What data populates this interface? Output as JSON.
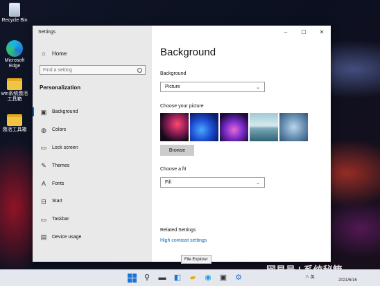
{
  "desktop": {
    "icons": [
      {
        "label": "Recycle Bin",
        "icon": "recycle-bin-icon"
      },
      {
        "label": "Microsoft Edge",
        "icon": "edge-icon"
      },
      {
        "label": "win系统激活工具箱",
        "icon": "folder-icon"
      },
      {
        "label": "激活工具箱",
        "icon": "folder-icon"
      }
    ]
  },
  "window": {
    "app_title": "Settings",
    "controls": {
      "minimize": "–",
      "maximize": "☐",
      "close": "✕"
    }
  },
  "sidebar": {
    "home_label": "Home",
    "search_placeholder": "Find a setting",
    "section_title": "Personalization",
    "items": [
      {
        "label": "Background",
        "icon": "image-icon",
        "glyph": "▣",
        "active": true
      },
      {
        "label": "Colors",
        "icon": "palette-icon",
        "glyph": "◍",
        "active": false
      },
      {
        "label": "Lock screen",
        "icon": "lock-screen-icon",
        "glyph": "▭",
        "active": false
      },
      {
        "label": "Themes",
        "icon": "brush-icon",
        "glyph": "✎",
        "active": false
      },
      {
        "label": "Fonts",
        "icon": "font-icon",
        "glyph": "A",
        "active": false
      },
      {
        "label": "Start",
        "icon": "start-icon",
        "glyph": "⊟",
        "active": false
      },
      {
        "label": "Taskbar",
        "icon": "taskbar-icon",
        "glyph": "▭",
        "active": false
      },
      {
        "label": "Device usage",
        "icon": "device-usage-icon",
        "glyph": "▤",
        "active": false
      }
    ]
  },
  "main": {
    "page_title": "Background",
    "background_label": "Background",
    "background_value": "Picture",
    "choose_picture_label": "Choose your picture",
    "browse_label": "Browse",
    "fit_label": "Choose a fit",
    "fit_value": "Fill",
    "related_title": "Related Settings",
    "related_link": "High contrast settings"
  },
  "tooltip": "File Explorer",
  "taskbar": {
    "tray_text": "∧ 英",
    "date": "2021/6/16"
  },
  "watermark": "网易号 | 系统秘籍",
  "colors": {
    "accent": "#0067c0",
    "sidebar_bg": "#e9e9e9",
    "taskbar_bg": "#e4e8ee"
  }
}
